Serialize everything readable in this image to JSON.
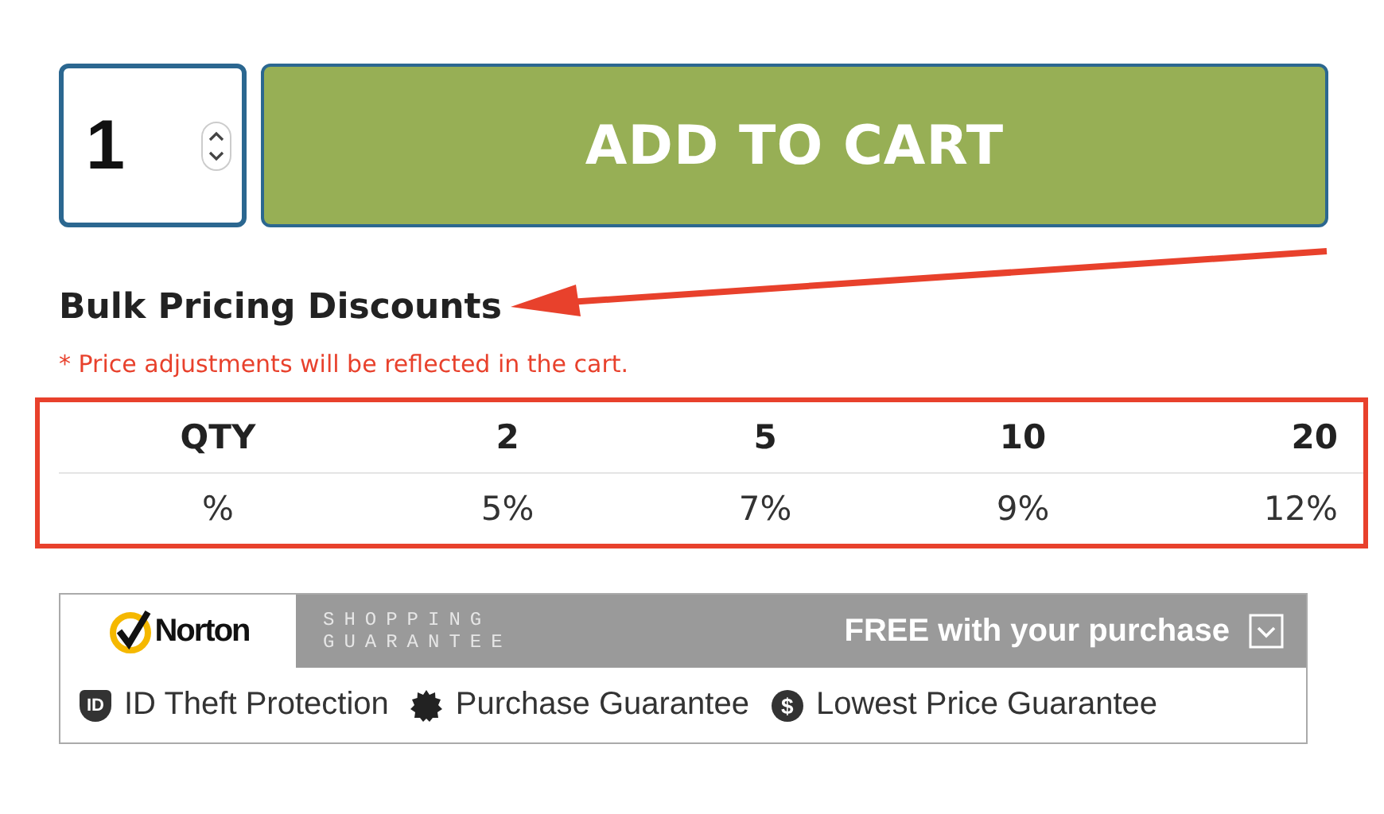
{
  "quantity": {
    "value": "1"
  },
  "add_button": "ADD TO CART",
  "bulk": {
    "title": "Bulk Pricing Discounts",
    "note": "* Price adjustments will be reflected in the cart.",
    "columns": [
      "QTY",
      "2",
      "5",
      "10",
      "20"
    ],
    "row": [
      "%",
      "5%",
      "7%",
      "9%",
      "12%"
    ]
  },
  "norton": {
    "brand": "Norton",
    "tagline_1": "SHOPPING",
    "tagline_2": "GUARANTEE",
    "offer": "FREE with your purchase",
    "features": [
      {
        "kind": "shield",
        "glyph": "ID",
        "label": "ID Theft Protection"
      },
      {
        "kind": "seal",
        "label": "Purchase Guarantee"
      },
      {
        "kind": "coin",
        "glyph": "$",
        "label": "Lowest Price Guarantee"
      }
    ]
  }
}
